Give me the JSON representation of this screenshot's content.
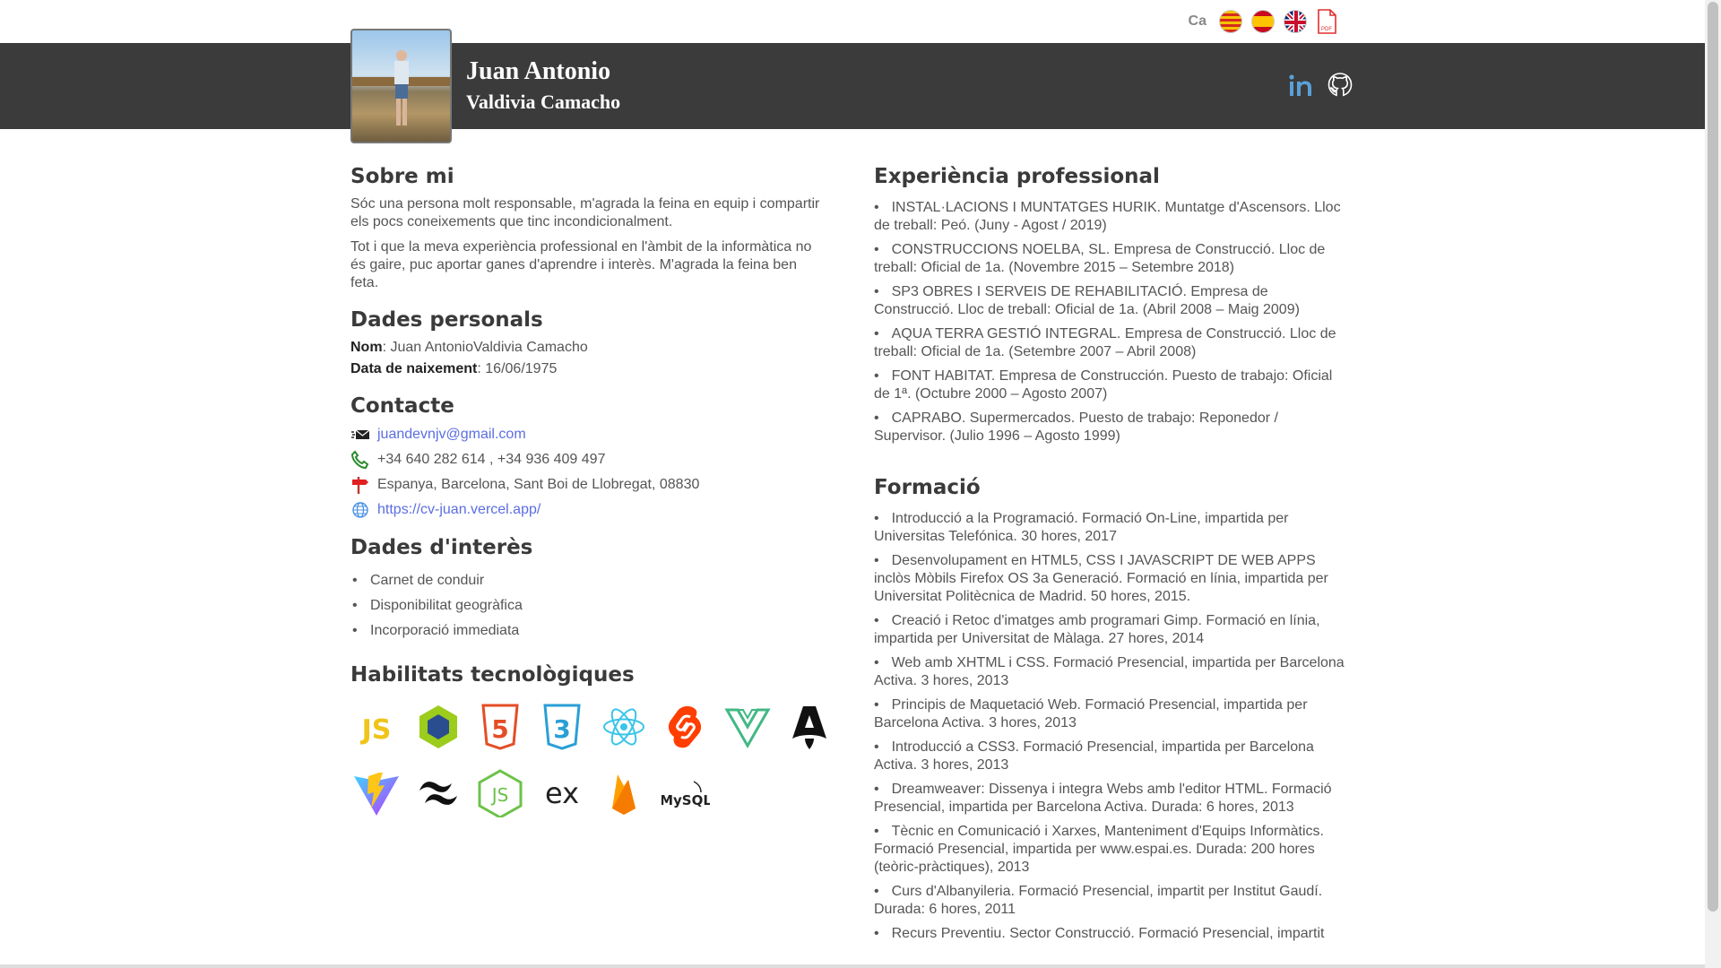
{
  "lang": {
    "code": "Ca",
    "flags": [
      "catalan-flag-icon",
      "spanish-flag-icon",
      "uk-flag-icon"
    ],
    "pdf": "PDF"
  },
  "header": {
    "first_name": "Juan Antonio",
    "last_name": "Valdivia Camacho",
    "social": [
      "linkedin-icon",
      "github-icon"
    ]
  },
  "about": {
    "title": "Sobre mi",
    "p1": "Sóc una persona molt responsable, m'agrada la feina en equip i compartir els pocs coneixements que tinc incondicionalment.",
    "p2": "Tot i que la meva experiència professional en l'àmbit de la informàtica no és gaire, puc aportar ganes d'aprendre i interès. M'agrada la feina ben feta."
  },
  "personal": {
    "title": "Dades personals",
    "name_label": "Nom",
    "name_value": ": Juan AntonioValdivia Camacho",
    "dob_label": "Data de naixement",
    "dob_value": ": 16/06/1975"
  },
  "contact": {
    "title": "Contacte",
    "email": "juandevnjv@gmail.com",
    "phone": "+34 640 282 614 ,  +34 936 409 497",
    "address": "Espanya, Barcelona, Sant Boi de Llobregat, 08830",
    "website": "https://cv-juan.vercel.app/"
  },
  "interest": {
    "title": "Dades d'interès",
    "items": [
      "Carnet de conduir",
      "Disponibilitat geogràfica",
      "Incorporació immediata"
    ]
  },
  "skills": {
    "title": "Habilitats tecnològiques",
    "labels": {
      "mysql": "MySQL",
      "express": "ex",
      "js": "JS"
    }
  },
  "experience": {
    "title": "Experiència professional",
    "items": [
      "INSTAL·LACIONS I MUNTATGES HURIK. Muntatge d'Ascensors. Lloc de treball: Peó. (Juny - Agost / 2019)",
      "CONSTRUCCIONS NOELBA, SL. Empresa de Construcció. Lloc de treball: Oficial de 1a. (Novembre 2015 – Setembre 2018)",
      "SP3 OBRES I SERVEIS DE REHABILITACIÓ. Empresa de Construcció. Lloc de treball: Oficial de 1a. (Abril 2008 – Maig 2009)",
      "AQUA TERRA GESTIÓ INTEGRAL. Empresa de Construcció. Lloc de treball: Oficial de 1a. (Setembre 2007 – Abril 2008)",
      "FONT HABITAT. Empresa de Construcción. Puesto de trabajo: Oficial de 1ª. (Octubre 2000 – Agosto 2007)",
      "CAPRABO. Supermercados. Puesto de trabajo: Reponedor / Supervisor. (Julio 1996 – Agosto 1999)"
    ]
  },
  "education": {
    "title": "Formació",
    "items": [
      "Introducció a la Programació. Formació On-Line, impartida per Universitas Telefónica. 30 hores, 2017",
      "Desenvolupament en HTML5, CSS I JAVASCRIPT DE WEB APPS inclòs Mòbils Firefox OS 3a Generació. Formació en línia, impartida per Universitat Politècnica de Madrid. 50 hores, 2015.",
      "Creació i Retoc d'imatges amb programari Gimp. Formació en línia, impartida per Universitat de Màlaga. 27 hores, 2014",
      "Web amb XHTML i CSS. Formació Presencial, impartida per Barcelona Activa. 3 hores, 2013",
      "Principis de Maquetació Web. Formació Presencial, impartida per Barcelona Activa. 3 hores, 2013",
      "Introducció a CSS3. Formació Presencial, impartida per Barcelona Activa. 3 hores, 2013",
      "Dreamweaver: Dissenya i integra Webs amb l'editor HTML. Formació Presencial, impartida per Barcelona Activa. Durada: 6 hores, 2013",
      "Tècnic en Comunicació i Xarxes, Manteniment d'Equips Informàtics. Formació Presencial, impartida per www.espai.es. Durada: 200 hores (teòric-pràctiques), 2013",
      "Curs d'Albanyileria. Formació Presencial, impartit per Institut Gaudí. Durada: 6 hores, 2011",
      "Recurs Preventiu. Sector Construcció. Formació Presencial, impartit"
    ]
  }
}
